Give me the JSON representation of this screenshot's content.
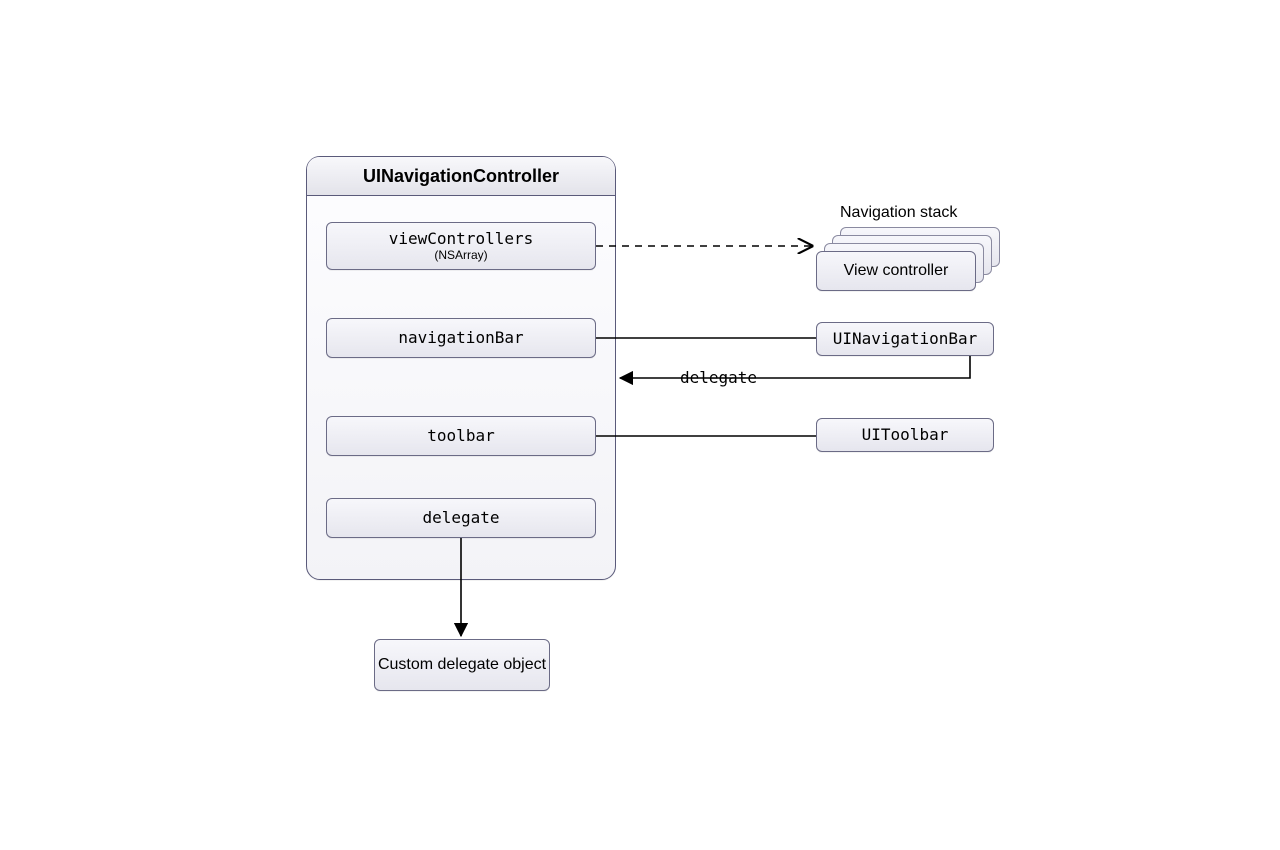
{
  "container": {
    "title": "UINavigationController"
  },
  "properties": {
    "viewControllers": {
      "label": "viewControllers",
      "sublabel": "(NSArray)"
    },
    "navigationBar": {
      "label": "navigationBar"
    },
    "toolbar": {
      "label": "toolbar"
    },
    "delegate": {
      "label": "delegate"
    }
  },
  "targets": {
    "navigationStack": {
      "caption": "Navigation stack",
      "box_label": "View controller"
    },
    "uiNavigationBar": {
      "label": "UINavigationBar"
    },
    "uiToolbar": {
      "label": "UIToolbar"
    },
    "customDelegate": {
      "label": "Custom delegate object"
    }
  },
  "edges": {
    "delegate_back_label": "delegate"
  }
}
